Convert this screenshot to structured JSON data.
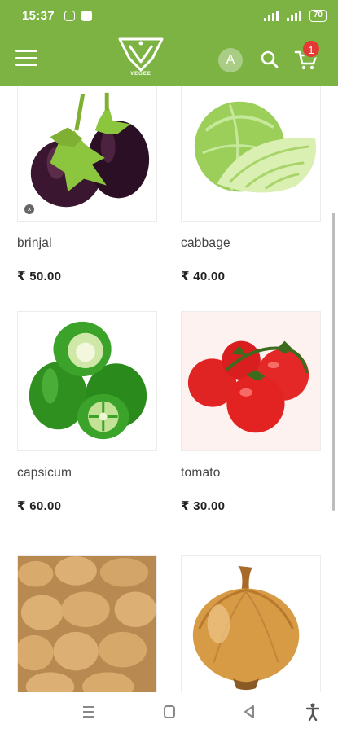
{
  "status": {
    "time": "15:37",
    "battery": "70"
  },
  "header": {
    "logo_text": "VEGEE",
    "avatar_letter": "A",
    "cart_count": "1"
  },
  "products": [
    {
      "name": "brinjal",
      "price": "₹ 50.00"
    },
    {
      "name": "cabbage",
      "price": "₹ 40.00"
    },
    {
      "name": "capsicum",
      "price": "₹ 60.00"
    },
    {
      "name": "tomato",
      "price": "₹ 30.00"
    },
    {
      "name": "potato",
      "price": ""
    },
    {
      "name": "onion",
      "price": ""
    }
  ],
  "colors": {
    "brand_green": "#7cb342",
    "badge_red": "#e53935"
  },
  "icons": {
    "menu": "hamburger-icon",
    "search": "search-icon",
    "cart": "cart-icon",
    "nav_recents": "recents-icon",
    "nav_home": "home-icon",
    "nav_back": "back-icon",
    "nav_accessibility": "accessibility-icon"
  }
}
